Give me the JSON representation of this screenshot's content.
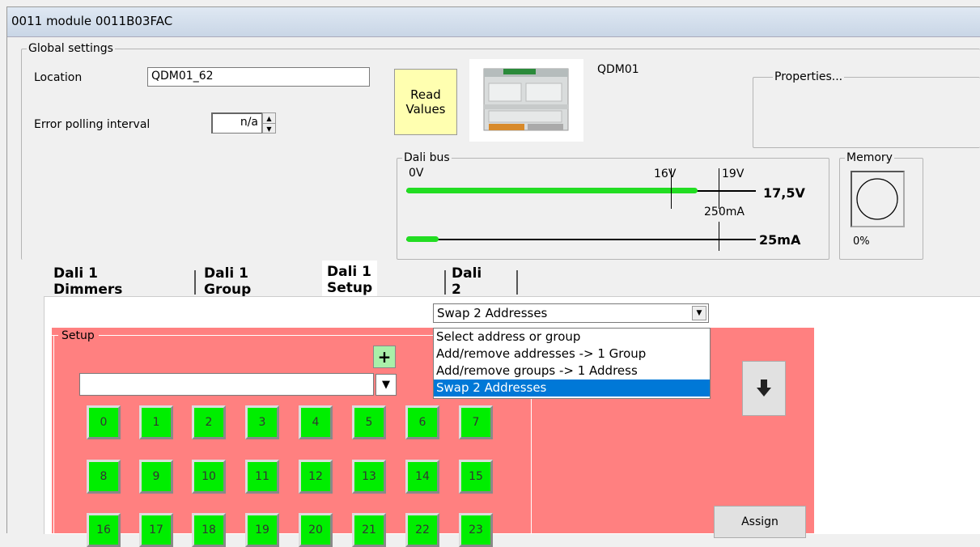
{
  "window": {
    "title": "0011 module 0011B03FAC"
  },
  "global": {
    "legend": "Global settings",
    "location_label": "Location",
    "location_value": "QDM01_62",
    "error_label": "Error polling interval",
    "error_value": "n/a",
    "read_values_line1": "Read",
    "read_values_line2": "Values",
    "device_name": "QDM01",
    "properties_legend": "Properties..."
  },
  "dali_bus": {
    "legend": "Dali bus",
    "v0": "0V",
    "v16": "16V",
    "v19": "19V",
    "voltage": "17,5V",
    "ma250": "250mA",
    "current": "25mA"
  },
  "memory": {
    "legend": "Memory",
    "value": "0%"
  },
  "tabs": [
    "Dali 1 Dimmers",
    "Dali 1 Group",
    "Dali 1 Setup",
    "Dali 2"
  ],
  "setup": {
    "selected_mode": "Swap 2 Addresses",
    "options": [
      "Select address or group",
      "Add/remove addresses -> 1 Group",
      "Add/remove groups -> 1 Address",
      "Swap 2 Addresses"
    ],
    "legend": "Setup",
    "plus_label": "+",
    "address_input": "",
    "assign_label": "Assign",
    "numbers": [
      "0",
      "1",
      "2",
      "3",
      "4",
      "5",
      "6",
      "7",
      "8",
      "9",
      "10",
      "11",
      "12",
      "13",
      "14",
      "15",
      "16",
      "17",
      "18",
      "19",
      "20",
      "21",
      "22",
      "23"
    ]
  },
  "colors": {
    "setup_bg": "#ff8080",
    "address_button": "#00ee00",
    "selected_option": "#0078d7"
  }
}
